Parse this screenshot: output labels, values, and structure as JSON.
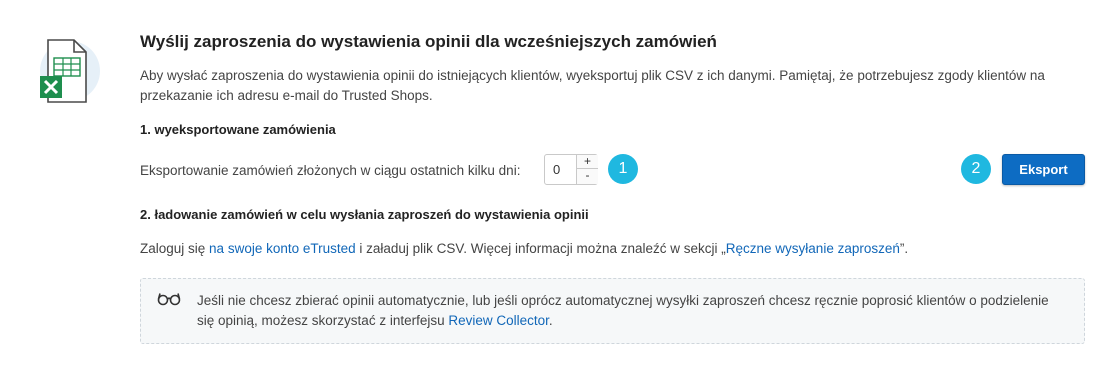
{
  "section": {
    "title": "Wyślij zaproszenia do wystawienia opinii dla wcześniejszych zamówień",
    "intro": "Aby wysłać zaproszenia do wystawienia opinii do istniejących klientów, wyeksportuj plik CSV z ich danymi. Pamiętaj, że potrzebujesz zgody klientów na przekazanie ich adresu e-mail do Trusted Shops.",
    "icon": "excel-file-icon"
  },
  "step1": {
    "title": "1. wyeksportowane zamówienia",
    "label": "Eksportowanie zamówień złożonych w ciągu ostatnich kilku dni:",
    "days_value": "0",
    "plus_label": "+",
    "minus_label": "-",
    "badge": "1"
  },
  "export": {
    "badge": "2",
    "button_label": "Eksport",
    "button_color": "#0d6cc3"
  },
  "step2": {
    "title": "2. ładowanie zamówień w celu wysłania zaproszeń do wystawienia opinii",
    "text_before": "Zaloguj się ",
    "link1": "na swoje konto eTrusted",
    "text_middle": " i załaduj plik CSV. Więcej informacji można znaleźć w sekcji „",
    "link2": "Ręczne wysyłanie zaproszeń",
    "text_after": "”."
  },
  "tip": {
    "icon": "glasses-icon",
    "text": "Jeśli nie chcesz zbierać opinii automatycznie, lub jeśli oprócz automatycznej wysyłki zaproszeń chcesz ręcznie poprosić klientów o podzielenie się opinią, możesz skorzystać z interfejsu ",
    "link": "Review Collector",
    "text_after": "."
  },
  "colors": {
    "badge": "#1fb8e0",
    "link": "#1167b8",
    "excel_green": "#1e8e4e"
  }
}
